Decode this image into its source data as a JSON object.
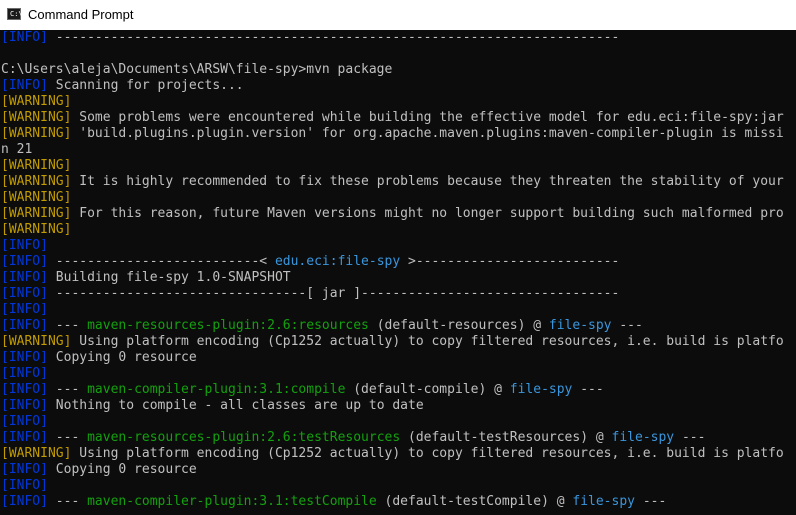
{
  "window": {
    "title": "Command Prompt",
    "icon": "cmd-console-icon",
    "icon_glyph": "C:\\"
  },
  "colors": {
    "background": "#0c0c0c",
    "text": "#c0c0c0",
    "info": "#0037da",
    "warning": "#c19c00",
    "cyan": "#3a96dd",
    "green": "#13a10e"
  },
  "lines": [
    [
      [
        "b",
        "["
      ],
      [
        "b",
        "INFO"
      ],
      [
        "b",
        "]"
      ],
      [
        "n",
        " ------------------------------------------------------------------------"
      ]
    ],
    [
      [
        "n",
        ""
      ]
    ],
    [
      [
        "n",
        "C:\\Users\\aleja\\Documents\\ARSW\\file-spy>mvn package"
      ]
    ],
    [
      [
        "b",
        "["
      ],
      [
        "b",
        "INFO"
      ],
      [
        "b",
        "]"
      ],
      [
        "n",
        " Scanning for projects..."
      ]
    ],
    [
      [
        "y",
        "[WARNING]"
      ]
    ],
    [
      [
        "y",
        "[WARNING]"
      ],
      [
        "n",
        " Some problems were encountered while building the effective model for edu.eci:file-spy:jar"
      ]
    ],
    [
      [
        "y",
        "[WARNING]"
      ],
      [
        "n",
        " 'build.plugins.plugin.version' for org.apache.maven.plugins:maven-compiler-plugin is missi"
      ]
    ],
    [
      [
        "n",
        "n 21"
      ]
    ],
    [
      [
        "y",
        "[WARNING]"
      ]
    ],
    [
      [
        "y",
        "[WARNING]"
      ],
      [
        "n",
        " It is highly recommended to fix these problems because they threaten the stability of your"
      ]
    ],
    [
      [
        "y",
        "[WARNING]"
      ]
    ],
    [
      [
        "y",
        "[WARNING]"
      ],
      [
        "n",
        " For this reason, future Maven versions might no longer support building such malformed pro"
      ]
    ],
    [
      [
        "y",
        "[WARNING]"
      ]
    ],
    [
      [
        "b",
        "["
      ],
      [
        "b",
        "INFO"
      ],
      [
        "b",
        "]"
      ]
    ],
    [
      [
        "b",
        "["
      ],
      [
        "b",
        "INFO"
      ],
      [
        "b",
        "]"
      ],
      [
        "n",
        " --------------------------< "
      ],
      [
        "t",
        "edu.eci:file-spy"
      ],
      [
        "n",
        " >--------------------------"
      ]
    ],
    [
      [
        "b",
        "["
      ],
      [
        "b",
        "INFO"
      ],
      [
        "b",
        "]"
      ],
      [
        "n",
        " Building file-spy 1.0-SNAPSHOT"
      ]
    ],
    [
      [
        "b",
        "["
      ],
      [
        "b",
        "INFO"
      ],
      [
        "b",
        "]"
      ],
      [
        "n",
        " --------------------------------[ jar ]---------------------------------"
      ]
    ],
    [
      [
        "b",
        "["
      ],
      [
        "b",
        "INFO"
      ],
      [
        "b",
        "]"
      ]
    ],
    [
      [
        "b",
        "["
      ],
      [
        "b",
        "INFO"
      ],
      [
        "b",
        "]"
      ],
      [
        "n",
        " --- "
      ],
      [
        "g",
        "maven-resources-plugin:2.6:resources"
      ],
      [
        "n",
        " (default-resources) @ "
      ],
      [
        "t",
        "file-spy"
      ],
      [
        "n",
        " ---"
      ]
    ],
    [
      [
        "y",
        "[WARNING]"
      ],
      [
        "n",
        " Using platform encoding (Cp1252 actually) to copy filtered resources, i.e. build is platfo"
      ]
    ],
    [
      [
        "b",
        "["
      ],
      [
        "b",
        "INFO"
      ],
      [
        "b",
        "]"
      ],
      [
        "n",
        " Copying 0 resource"
      ]
    ],
    [
      [
        "b",
        "["
      ],
      [
        "b",
        "INFO"
      ],
      [
        "b",
        "]"
      ]
    ],
    [
      [
        "b",
        "["
      ],
      [
        "b",
        "INFO"
      ],
      [
        "b",
        "]"
      ],
      [
        "n",
        " --- "
      ],
      [
        "g",
        "maven-compiler-plugin:3.1:compile"
      ],
      [
        "n",
        " (default-compile) @ "
      ],
      [
        "t",
        "file-spy"
      ],
      [
        "n",
        " ---"
      ]
    ],
    [
      [
        "b",
        "["
      ],
      [
        "b",
        "INFO"
      ],
      [
        "b",
        "]"
      ],
      [
        "n",
        " Nothing to compile - all classes are up to date"
      ]
    ],
    [
      [
        "b",
        "["
      ],
      [
        "b",
        "INFO"
      ],
      [
        "b",
        "]"
      ]
    ],
    [
      [
        "b",
        "["
      ],
      [
        "b",
        "INFO"
      ],
      [
        "b",
        "]"
      ],
      [
        "n",
        " --- "
      ],
      [
        "g",
        "maven-resources-plugin:2.6:testResources"
      ],
      [
        "n",
        " (default-testResources) @ "
      ],
      [
        "t",
        "file-spy"
      ],
      [
        "n",
        " ---"
      ]
    ],
    [
      [
        "y",
        "[WARNING]"
      ],
      [
        "n",
        " Using platform encoding (Cp1252 actually) to copy filtered resources, i.e. build is platfo"
      ]
    ],
    [
      [
        "b",
        "["
      ],
      [
        "b",
        "INFO"
      ],
      [
        "b",
        "]"
      ],
      [
        "n",
        " Copying 0 resource"
      ]
    ],
    [
      [
        "b",
        "["
      ],
      [
        "b",
        "INFO"
      ],
      [
        "b",
        "]"
      ]
    ],
    [
      [
        "b",
        "["
      ],
      [
        "b",
        "INFO"
      ],
      [
        "b",
        "]"
      ],
      [
        "n",
        " --- "
      ],
      [
        "g",
        "maven-compiler-plugin:3.1:testCompile"
      ],
      [
        "n",
        " (default-testCompile) @ "
      ],
      [
        "t",
        "file-spy"
      ],
      [
        "n",
        " ---"
      ]
    ]
  ]
}
